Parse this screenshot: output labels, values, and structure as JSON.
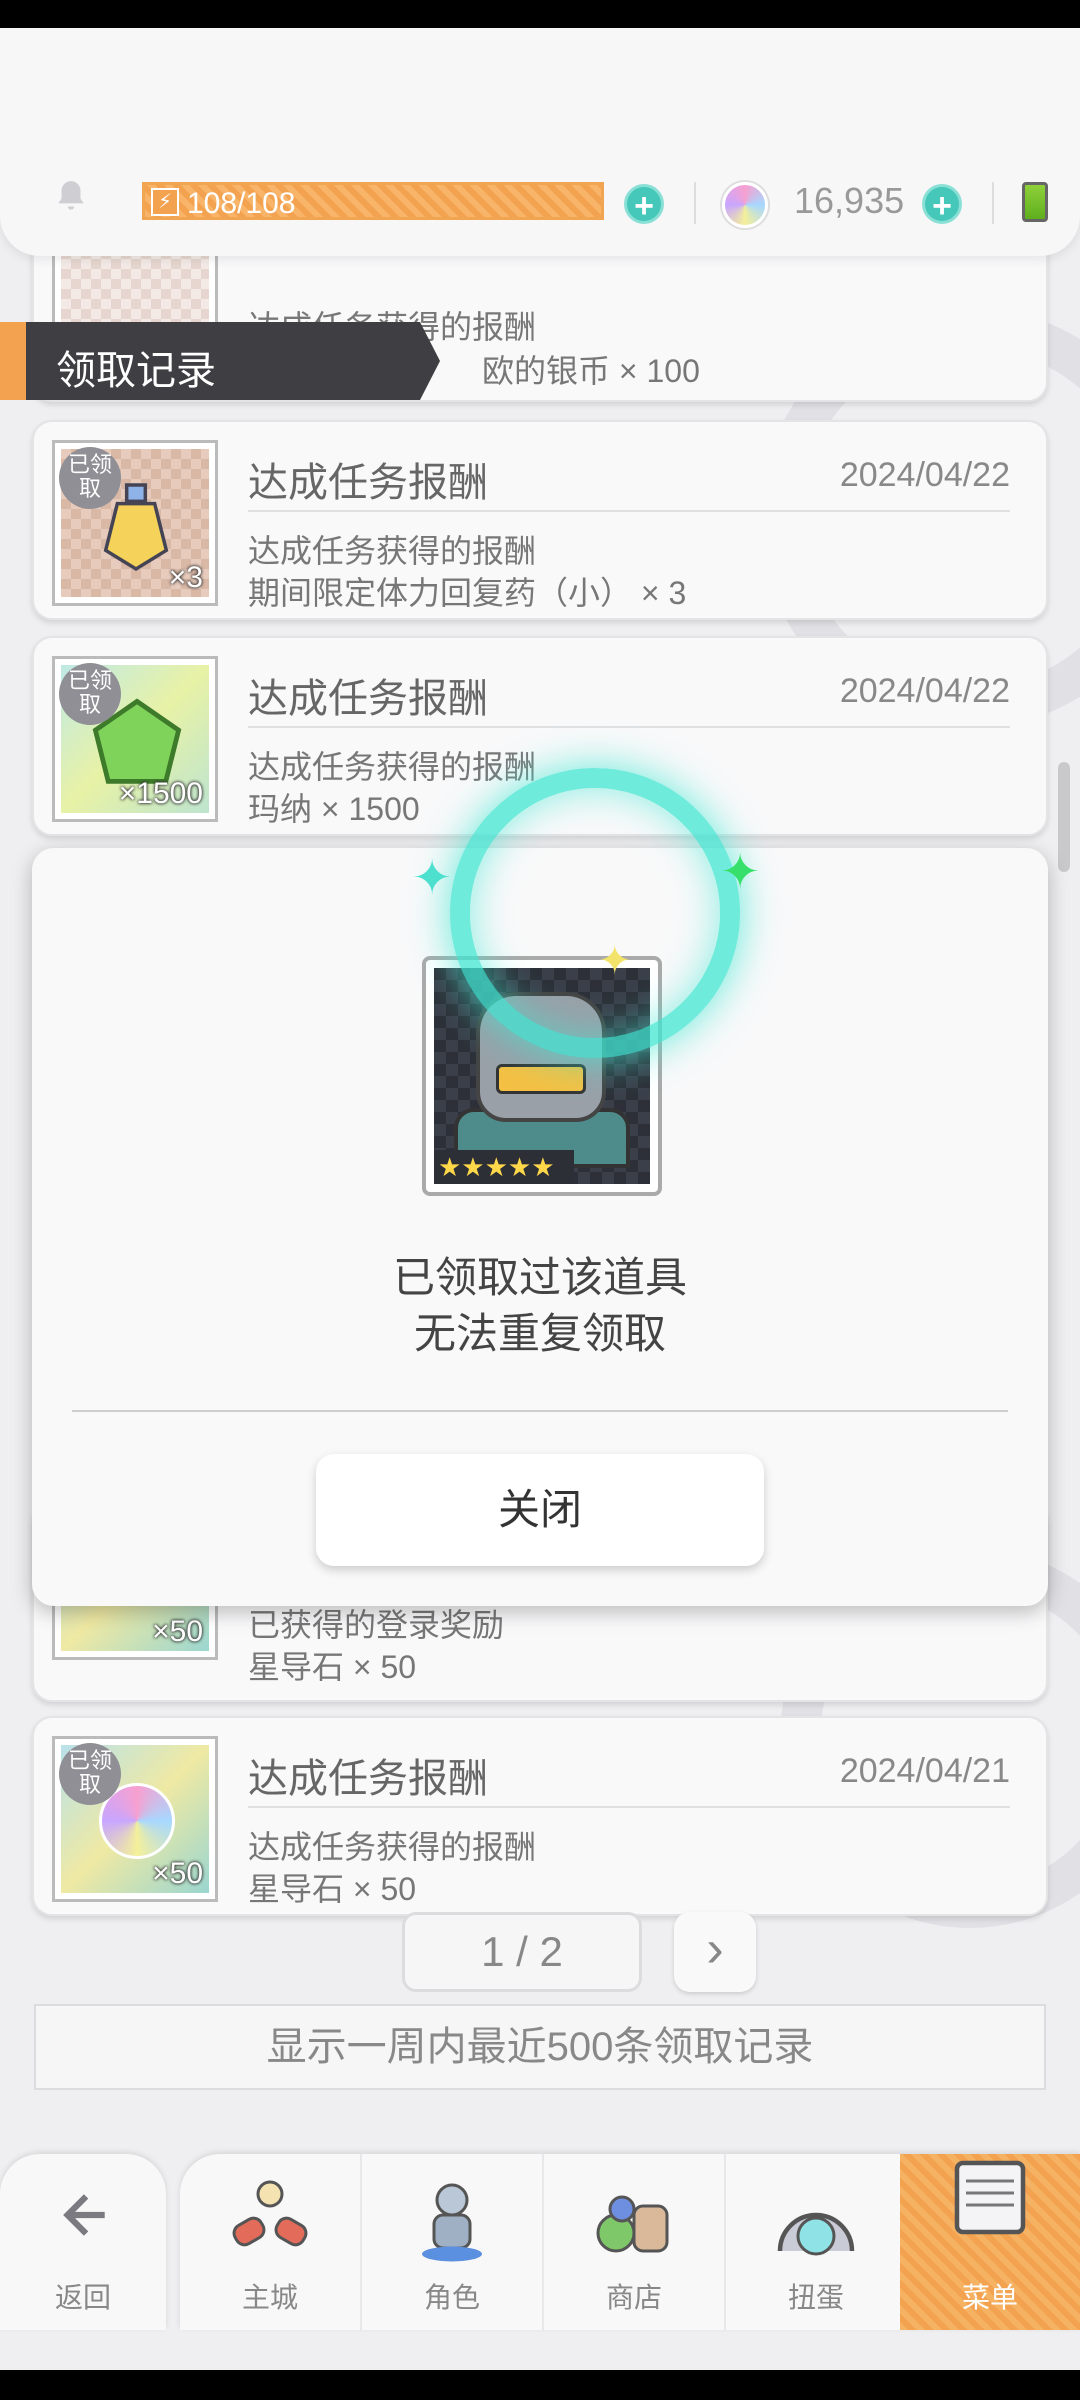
{
  "header": {
    "stamina": "108/108",
    "gems": "16,935"
  },
  "section": {
    "title": "领取记录"
  },
  "records": [
    {
      "title": "",
      "date": "",
      "desc": "达成任务获得的报酬",
      "item": "欧的银币 × 100",
      "qty": ""
    },
    {
      "title": "达成任务报酬",
      "date": "2024/04/22",
      "desc": "达成任务获得的报酬",
      "item": "期间限定体力回复药（小） × 3",
      "qty": "×3",
      "badge": "已领取"
    },
    {
      "title": "达成任务报酬",
      "date": "2024/04/22",
      "desc": "达成任务获得的报酬",
      "item": "玛纳 × 1500",
      "qty": "×1500",
      "badge": "已领取"
    },
    {
      "title": "",
      "date": "",
      "desc": "已获得的登录奖励",
      "item": "星导石 × 50",
      "qty": "×50"
    },
    {
      "title": "达成任务报酬",
      "date": "2024/04/21",
      "desc": "达成任务获得的报酬",
      "item": "星导石 × 50",
      "qty": "×50",
      "badge": "已领取"
    }
  ],
  "pagination": {
    "label": "1 / 2",
    "next": "›"
  },
  "notice": "显示一周内最近500条领取记录",
  "modal": {
    "stars": "★★★★★",
    "line1": "已领取过该道具",
    "line2": "无法重复领取",
    "close": "关闭"
  },
  "nav": {
    "back": "返回",
    "tabs": [
      "主城",
      "角色",
      "商店",
      "扭蛋",
      "菜单"
    ]
  },
  "colors": {
    "accent": "#f3a24f",
    "teal": "#45c7b9",
    "glow": "#40e6d2"
  }
}
